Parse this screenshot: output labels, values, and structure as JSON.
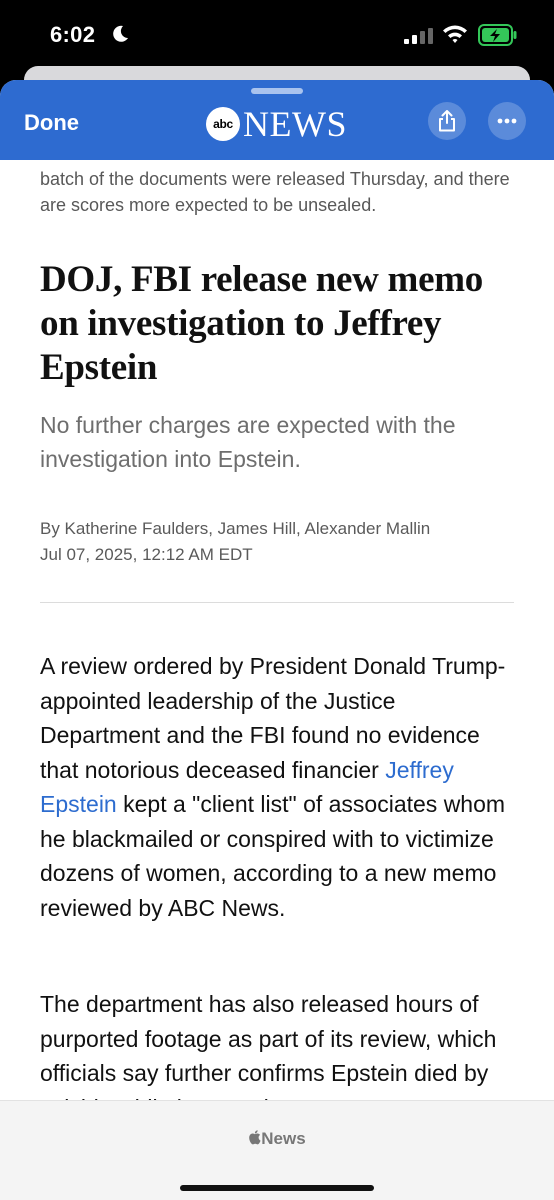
{
  "status_bar": {
    "time": "6:02"
  },
  "header": {
    "done_label": "Done",
    "brand_abc": "abc",
    "brand_news": "NEWS"
  },
  "article": {
    "previous_text": "batch of the documents were released Thursday, and there are scores more expected to be unsealed.",
    "headline": "DOJ, FBI release new memo on investigation to Jeffrey Epstein",
    "subhead": "No further charges are expected with the investigation into Epstein.",
    "byline": "By Katherine Faulders, James Hill, Alexander Mallin",
    "date": "Jul 07, 2025, 12:12 AM EDT",
    "para1_before_link": "A review ordered by President Donald Trump-appointed leadership of the Justice Department and the FBI found no evidence that notorious deceased financier ",
    "para1_link": "Jeffrey Epstein",
    "para1_after_link": " kept a \"client list\" of associates whom he blackmailed or conspired with to victimize dozens of women, according to a new memo reviewed by ABC News.",
    "para2": "The department has also released hours of purported footage as part of its review, which officials say further confirms Epstein died by suicide while in custody"
  },
  "footer": {
    "brand": "News"
  },
  "colors": {
    "header_blue": "#2e6bd0",
    "link_blue": "#2d6ccf",
    "battery_green": "#34c759"
  }
}
